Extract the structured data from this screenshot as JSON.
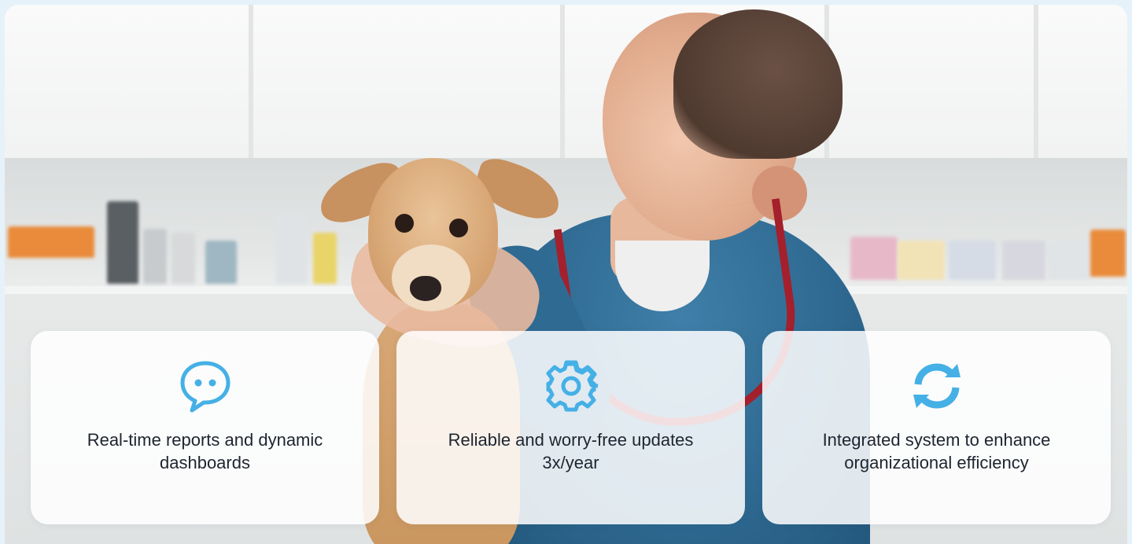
{
  "features": [
    {
      "icon": "chat-bubble-icon",
      "label": "Real-time reports and dynamic dashboards"
    },
    {
      "icon": "gear-icon",
      "label": "Reliable and worry-free updates 3x/year"
    },
    {
      "icon": "sync-icon",
      "label": "Integrated system to enhance organizational efficiency"
    }
  ],
  "colors": {
    "icon_accent": "#45b0e6",
    "card_background": "#ffffff",
    "text": "#1e2530",
    "page_background": "#e6f2fa"
  }
}
